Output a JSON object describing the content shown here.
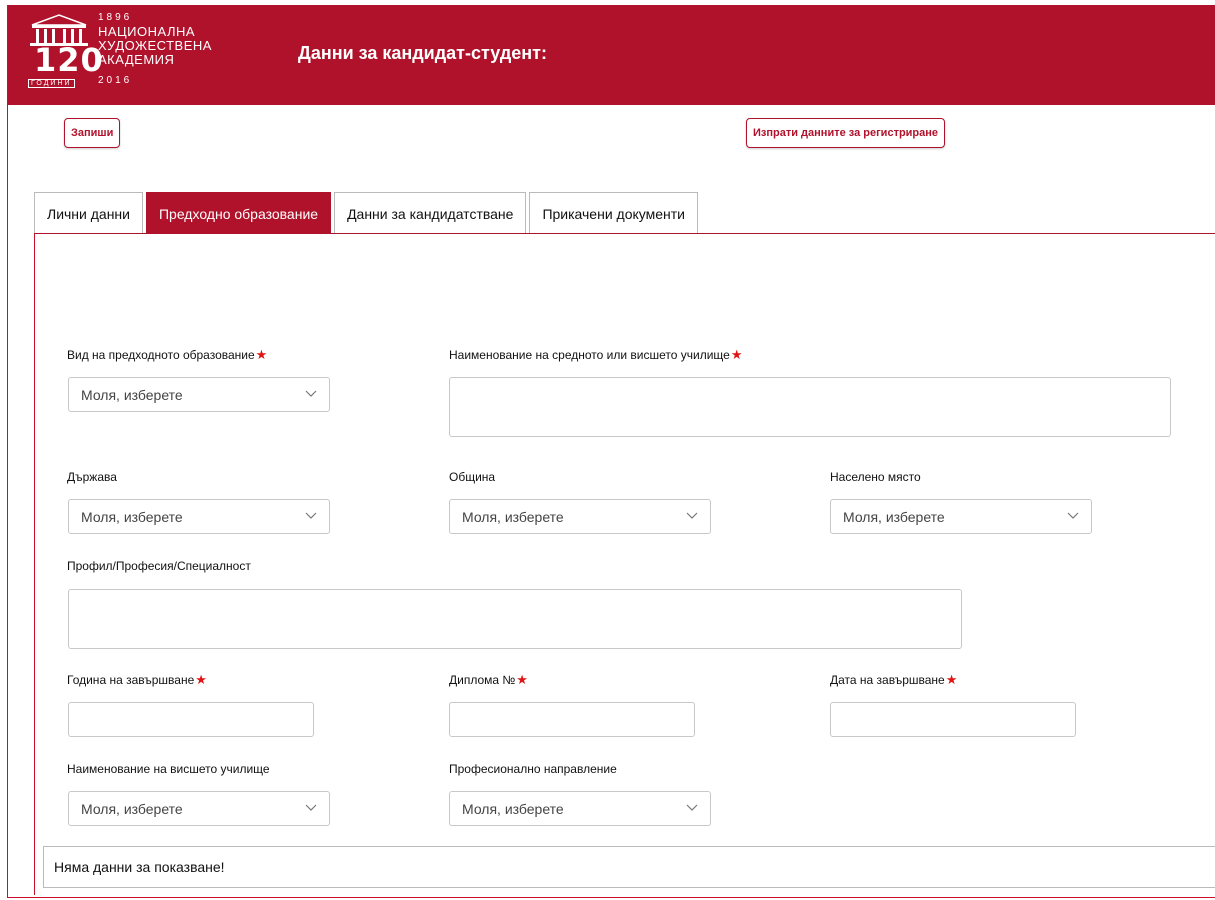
{
  "header": {
    "logo": {
      "year_top": "1896",
      "line1": "НАЦИОНАЛНА",
      "line2": "ХУДОЖЕСТВЕНА",
      "line3": "АКАДЕМИЯ",
      "year_bottom": "2016",
      "anniversary": "120",
      "anniversary_sub": "ГОДИНИ"
    },
    "title": "Данни за кандидат-студент:"
  },
  "actions": {
    "save_label": "Запиши",
    "submit_label": "Изпрати данните за регистриране"
  },
  "tabs": [
    {
      "label": "Лични данни",
      "active": false
    },
    {
      "label": "Предходно образование",
      "active": true
    },
    {
      "label": "Данни за кандидатстване",
      "active": false
    },
    {
      "label": "Прикачени документи",
      "active": false
    }
  ],
  "form": {
    "education_type": {
      "label": "Вид на предходното образование",
      "required": true,
      "value": "Моля, изберете"
    },
    "school_name": {
      "label": "Наименование на средното или висшето училище",
      "required": true,
      "value": ""
    },
    "country": {
      "label": "Държава",
      "value": "Моля, изберете"
    },
    "municipality": {
      "label": "Община",
      "value": "Моля, изберете"
    },
    "settlement": {
      "label": "Населено място",
      "value": "Моля, изберете"
    },
    "profile": {
      "label": "Профил/Професия/Специалност",
      "value": ""
    },
    "graduation_year": {
      "label": "Година на завършване",
      "required": true,
      "value": ""
    },
    "diploma_no": {
      "label": "Диплома №",
      "required": true,
      "value": ""
    },
    "graduation_date": {
      "label": "Дата на завършване",
      "required": true,
      "value": ""
    },
    "university_name": {
      "label": "Наименование на висшето училище",
      "value": "Моля, изберете"
    },
    "professional_field": {
      "label": "Професионално направление",
      "value": "Моля, изберете"
    }
  },
  "required_marker": "★",
  "no_data_text": "Няма данни за показване!",
  "colors": {
    "brand": "#b1122b",
    "required": "#e01414"
  }
}
